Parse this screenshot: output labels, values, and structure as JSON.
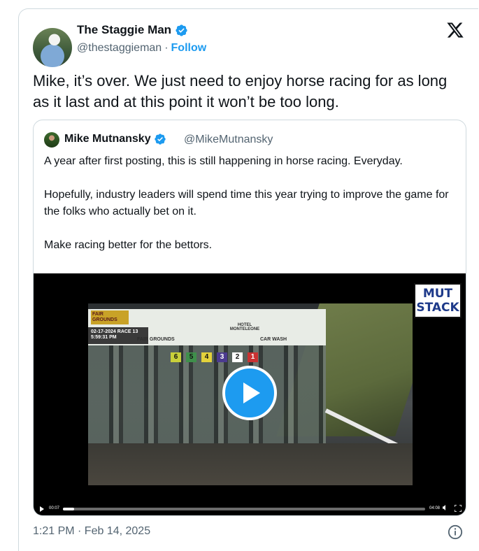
{
  "tweet": {
    "author_name": "The Staggie Man",
    "author_handle": "@thestaggieman",
    "separator": "·",
    "follow_label": "Follow",
    "text": "Mike, it’s over. We just need to enjoy horse racing for as long as it last and at this point it won’t be too long.",
    "timestamp": "1:21 PM · Feb 14, 2025"
  },
  "quote": {
    "author_name": "Mike Mutnansky",
    "author_handle": "@MikeMutnansky",
    "paragraphs": [
      "A year after first posting, this is still happening in horse racing. Everyday.",
      "Hopefully, industry leaders will spend time this year trying to improve the game for the folks who actually bet on it.",
      "Make racing better for the bettors."
    ]
  },
  "video": {
    "overlay_logo": "FAIR GROUNDS",
    "overlay_date": "02-17-2024",
    "overlay_race": "RACE 13",
    "overlay_time": "5:59:31 PM",
    "banner_labels": [
      "FAIR GROUNDS",
      "HOTEL MONTELEONE",
      "CAR WASH"
    ],
    "gate_numbers": [
      "6",
      "5",
      "4",
      "3",
      "2",
      "1"
    ],
    "watermark": [
      "MUT",
      "STACK"
    ],
    "current_time": "00:07",
    "duration": "04:08",
    "progress_fraction": 0.03
  },
  "colors": {
    "accent": "#1d9bf0",
    "text": "#0f1419",
    "muted": "#536471",
    "border": "#cfd9de",
    "gate_colors": [
      "#c9d03a",
      "#3f8f4b",
      "#e3d23b",
      "#4b3a8f",
      "#ffffff",
      "#c93232"
    ]
  },
  "icons": {
    "verified": "verified-badge-icon",
    "x_logo": "x-logo-icon",
    "play": "play-icon",
    "info": "info-icon"
  }
}
